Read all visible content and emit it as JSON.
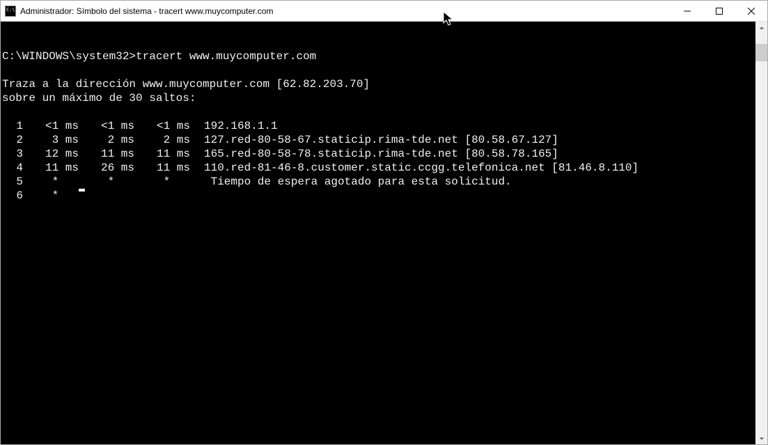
{
  "titlebar": {
    "title": "Administrador: Símbolo del sistema - tracert  www.muycomputer.com"
  },
  "terminal": {
    "prompt": "C:\\WINDOWS\\system32>",
    "command": "tracert www.muycomputer.com",
    "trace_header_1": "Traza a la dirección www.muycomputer.com [62.82.203.70]",
    "trace_header_2": "sobre un máximo de 30 saltos:",
    "hops": [
      {
        "n": "1",
        "t1": "<1 ms",
        "t2": "<1 ms",
        "t3": "<1 ms",
        "host": "192.168.1.1"
      },
      {
        "n": "2",
        "t1": "3 ms",
        "t2": "2 ms",
        "t3": "2 ms",
        "host": "127.red-80-58-67.staticip.rima-tde.net [80.58.67.127]"
      },
      {
        "n": "3",
        "t1": "12 ms",
        "t2": "11 ms",
        "t3": "11 ms",
        "host": "165.red-80-58-78.staticip.rima-tde.net [80.58.78.165]"
      },
      {
        "n": "4",
        "t1": "11 ms",
        "t2": "26 ms",
        "t3": "11 ms",
        "host": "110.red-81-46-8.customer.static.ccgg.telefonica.net [81.46.8.110]"
      },
      {
        "n": "5",
        "t1": "*   ",
        "t2": "*   ",
        "t3": "*   ",
        "host": " Tiempo de espera agotado para esta solicitud."
      },
      {
        "n": "6",
        "t1": "*   ",
        "t2": "",
        "t3": "",
        "host": ""
      }
    ]
  }
}
